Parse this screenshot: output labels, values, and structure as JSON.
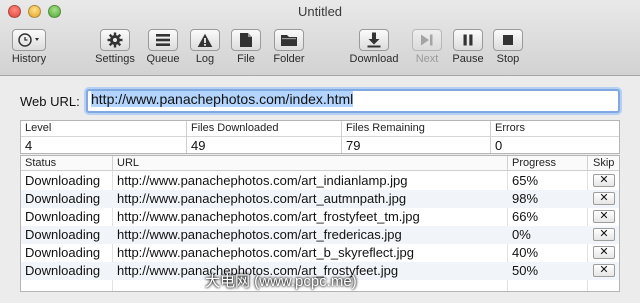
{
  "window": {
    "title": "Untitled"
  },
  "toolbar": {
    "history": "History",
    "settings": "Settings",
    "queue": "Queue",
    "log": "Log",
    "file": "File",
    "folder": "Folder",
    "download": "Download",
    "next": "Next",
    "pause": "Pause",
    "stop": "Stop"
  },
  "url_bar": {
    "label": "Web URL:",
    "value": "http://www.panachephotos.com/index.html"
  },
  "stats": {
    "headers": [
      "Level",
      "Files Downloaded",
      "Files Remaining",
      "Errors"
    ],
    "values": [
      "4",
      "49",
      "79",
      "0"
    ]
  },
  "queue": {
    "headers": {
      "status": "Status",
      "url": "URL",
      "progress": "Progress",
      "skip": "Skip"
    },
    "skip_label": "✕",
    "rows": [
      {
        "status": "Downloading",
        "url": "http://www.panachephotos.com/art_indianlamp.jpg",
        "progress": "65%"
      },
      {
        "status": "Downloading",
        "url": "http://www.panachephotos.com/art_autmnpath.jpg",
        "progress": "98%"
      },
      {
        "status": "Downloading",
        "url": "http://www.panachephotos.com/art_frostyfeet_tm.jpg",
        "progress": "66%"
      },
      {
        "status": "Downloading",
        "url": "http://www.panachephotos.com/art_fredericas.jpg",
        "progress": "0%"
      },
      {
        "status": "Downloading",
        "url": "http://www.panachephotos.com/art_b_skyreflect.jpg",
        "progress": "40%"
      },
      {
        "status": "Downloading",
        "url": "http://www.panachephotos.com/art_frostyfeet.jpg",
        "progress": "50%"
      }
    ]
  },
  "watermark": "大电网 (www.pcpc.me)"
}
